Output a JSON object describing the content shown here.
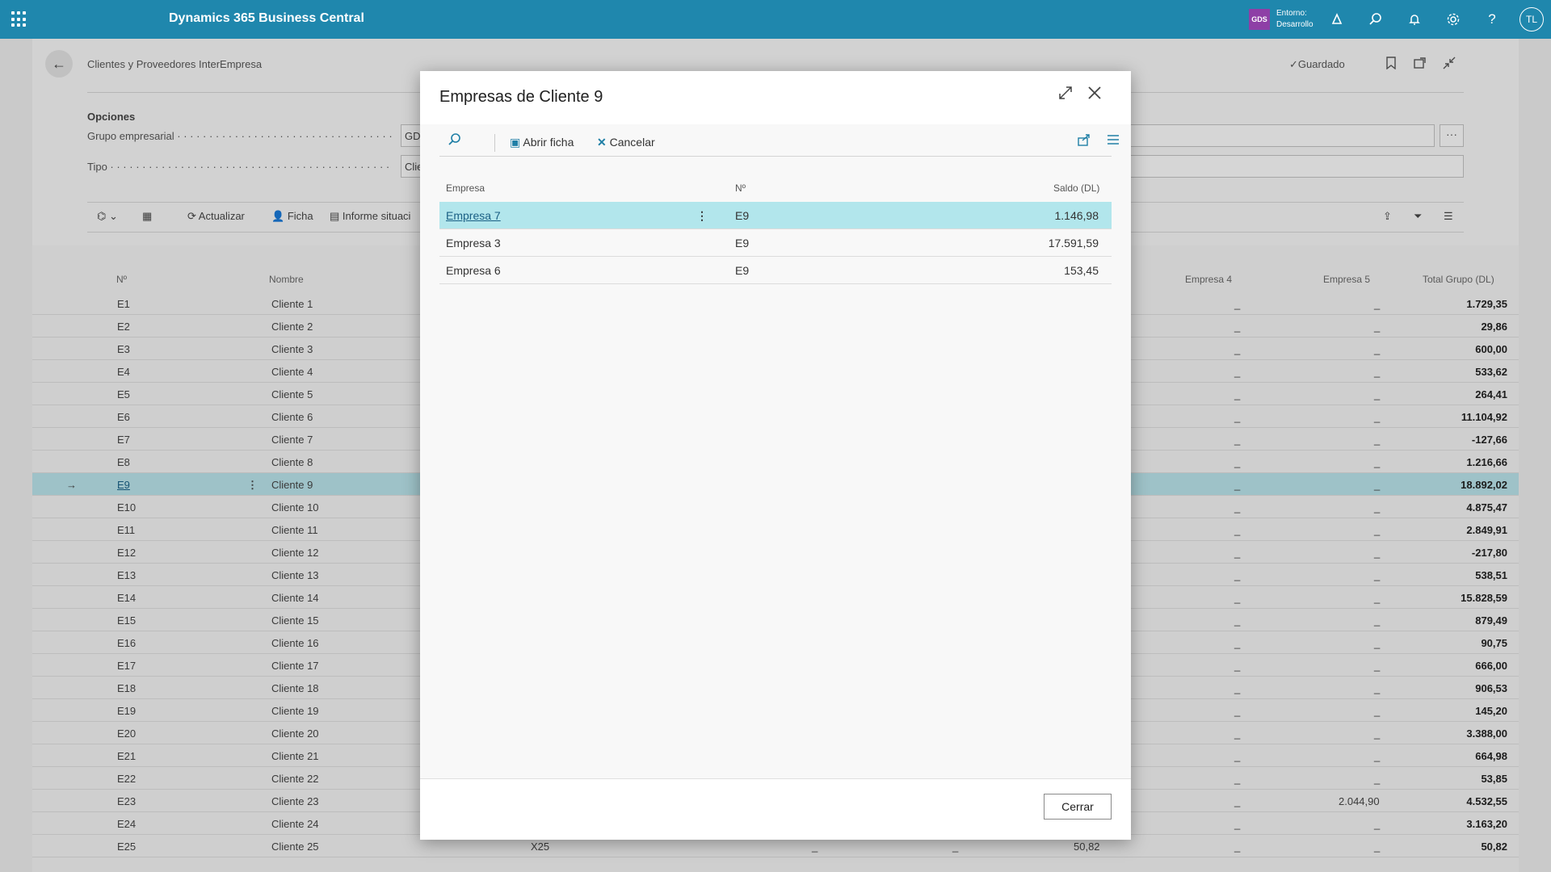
{
  "topbar": {
    "app_title": "Dynamics 365 Business Central",
    "env_badge": "GDS",
    "env_label": "Entorno:",
    "env_value": "Desarrollo",
    "avatar": "TL",
    "icons": [
      "copilot-icon",
      "search-icon",
      "bell-icon",
      "gear-icon",
      "help-icon"
    ]
  },
  "page": {
    "breadcrumb": "Clientes y Proveedores InterEmpresa",
    "saved": "Guardado",
    "options_title": "Opciones",
    "fields": [
      {
        "label": "Grupo empresarial",
        "value": "GD"
      },
      {
        "label": "Tipo",
        "value": "Clie"
      }
    ],
    "actions": [
      "Actualizar",
      "Ficha",
      "Informe situaci"
    ],
    "columns": {
      "no": "Nº",
      "name": "Nombre",
      "e4": "Empresa 4",
      "e5": "Empresa 5",
      "total": "Total Grupo (DL)"
    },
    "rows": [
      {
        "no": "E1",
        "name": "Cliente 1",
        "e4": "_",
        "e5": "_",
        "total": "1.729,35"
      },
      {
        "no": "E2",
        "name": "Cliente 2",
        "e4": "_",
        "e5": "_",
        "total": "29,86"
      },
      {
        "no": "E3",
        "name": "Cliente 3",
        "e4": "_",
        "e5": "_",
        "total": "600,00"
      },
      {
        "no": "E4",
        "name": "Cliente 4",
        "e4": "_",
        "e5": "_",
        "total": "533,62"
      },
      {
        "no": "E5",
        "name": "Cliente 5",
        "e4": "_",
        "e5": "_",
        "total": "264,41"
      },
      {
        "no": "E6",
        "name": "Cliente 6",
        "e4": "_",
        "e5": "_",
        "total": "11.104,92"
      },
      {
        "no": "E7",
        "name": "Cliente 7",
        "e4": "_",
        "e5": "_",
        "total": "-127,66"
      },
      {
        "no": "E8",
        "name": "Cliente 8",
        "e4": "_",
        "e5": "_",
        "total": "1.216,66"
      },
      {
        "no": "E9",
        "name": "Cliente 9",
        "e4": "_",
        "e5": "_",
        "total": "18.892,02"
      },
      {
        "no": "E10",
        "name": "Cliente 10",
        "e4": "_",
        "e5": "_",
        "total": "4.875,47"
      },
      {
        "no": "E11",
        "name": "Cliente 11",
        "e4": "_",
        "e5": "_",
        "total": "2.849,91"
      },
      {
        "no": "E12",
        "name": "Cliente 12",
        "e4": "_",
        "e5": "_",
        "total": "-217,80"
      },
      {
        "no": "E13",
        "name": "Cliente 13",
        "e4": "_",
        "e5": "_",
        "total": "538,51"
      },
      {
        "no": "E14",
        "name": "Cliente 14",
        "e4": "_",
        "e5": "_",
        "total": "15.828,59"
      },
      {
        "no": "E15",
        "name": "Cliente 15",
        "e4": "_",
        "e5": "_",
        "total": "879,49"
      },
      {
        "no": "E16",
        "name": "Cliente 16",
        "e4": "_",
        "e5": "_",
        "total": "90,75"
      },
      {
        "no": "E17",
        "name": "Cliente 17",
        "e4": "_",
        "e5": "_",
        "total": "666,00"
      },
      {
        "no": "E18",
        "name": "Cliente 18",
        "e4": "_",
        "e5": "_",
        "total": "906,53"
      },
      {
        "no": "E19",
        "name": "Cliente 19",
        "e4": "_",
        "e5": "_",
        "total": "145,20"
      },
      {
        "no": "E20",
        "name": "Cliente 20",
        "e4": "_",
        "e5": "_",
        "total": "3.388,00"
      },
      {
        "no": "E21",
        "name": "Cliente 21",
        "e4": "_",
        "e5": "_",
        "total": "664,98"
      },
      {
        "no": "E22",
        "name": "Cliente 22",
        "e4": "_",
        "e5": "_",
        "total": "53,85"
      },
      {
        "no": "E23",
        "name": "Cliente 23",
        "e4": "_",
        "e5": "2.044,90",
        "total": "4.532,55"
      },
      {
        "no": "E24",
        "name": "Cliente 24",
        "e4": "_",
        "e5": "_",
        "total": "3.163,20"
      },
      {
        "no": "E25",
        "name": "Cliente 25",
        "e4": "_",
        "e5": "_",
        "total": "50,82",
        "extra_code": "X25",
        "extra_a": "_",
        "extra_b": "_",
        "extra_val": "50,82"
      }
    ]
  },
  "dialog": {
    "title": "Empresas de Cliente 9",
    "actions": {
      "open": "Abrir ficha",
      "cancel": "Cancelar"
    },
    "columns": {
      "company": "Empresa",
      "no": "Nº",
      "balance": "Saldo (DL)"
    },
    "rows": [
      {
        "company": "Empresa 7",
        "no": "E9",
        "balance": "1.146,98"
      },
      {
        "company": "Empresa 3",
        "no": "E9",
        "balance": "17.591,59"
      },
      {
        "company": "Empresa 6",
        "no": "E9",
        "balance": "153,45"
      }
    ],
    "close_label": "Cerrar"
  }
}
